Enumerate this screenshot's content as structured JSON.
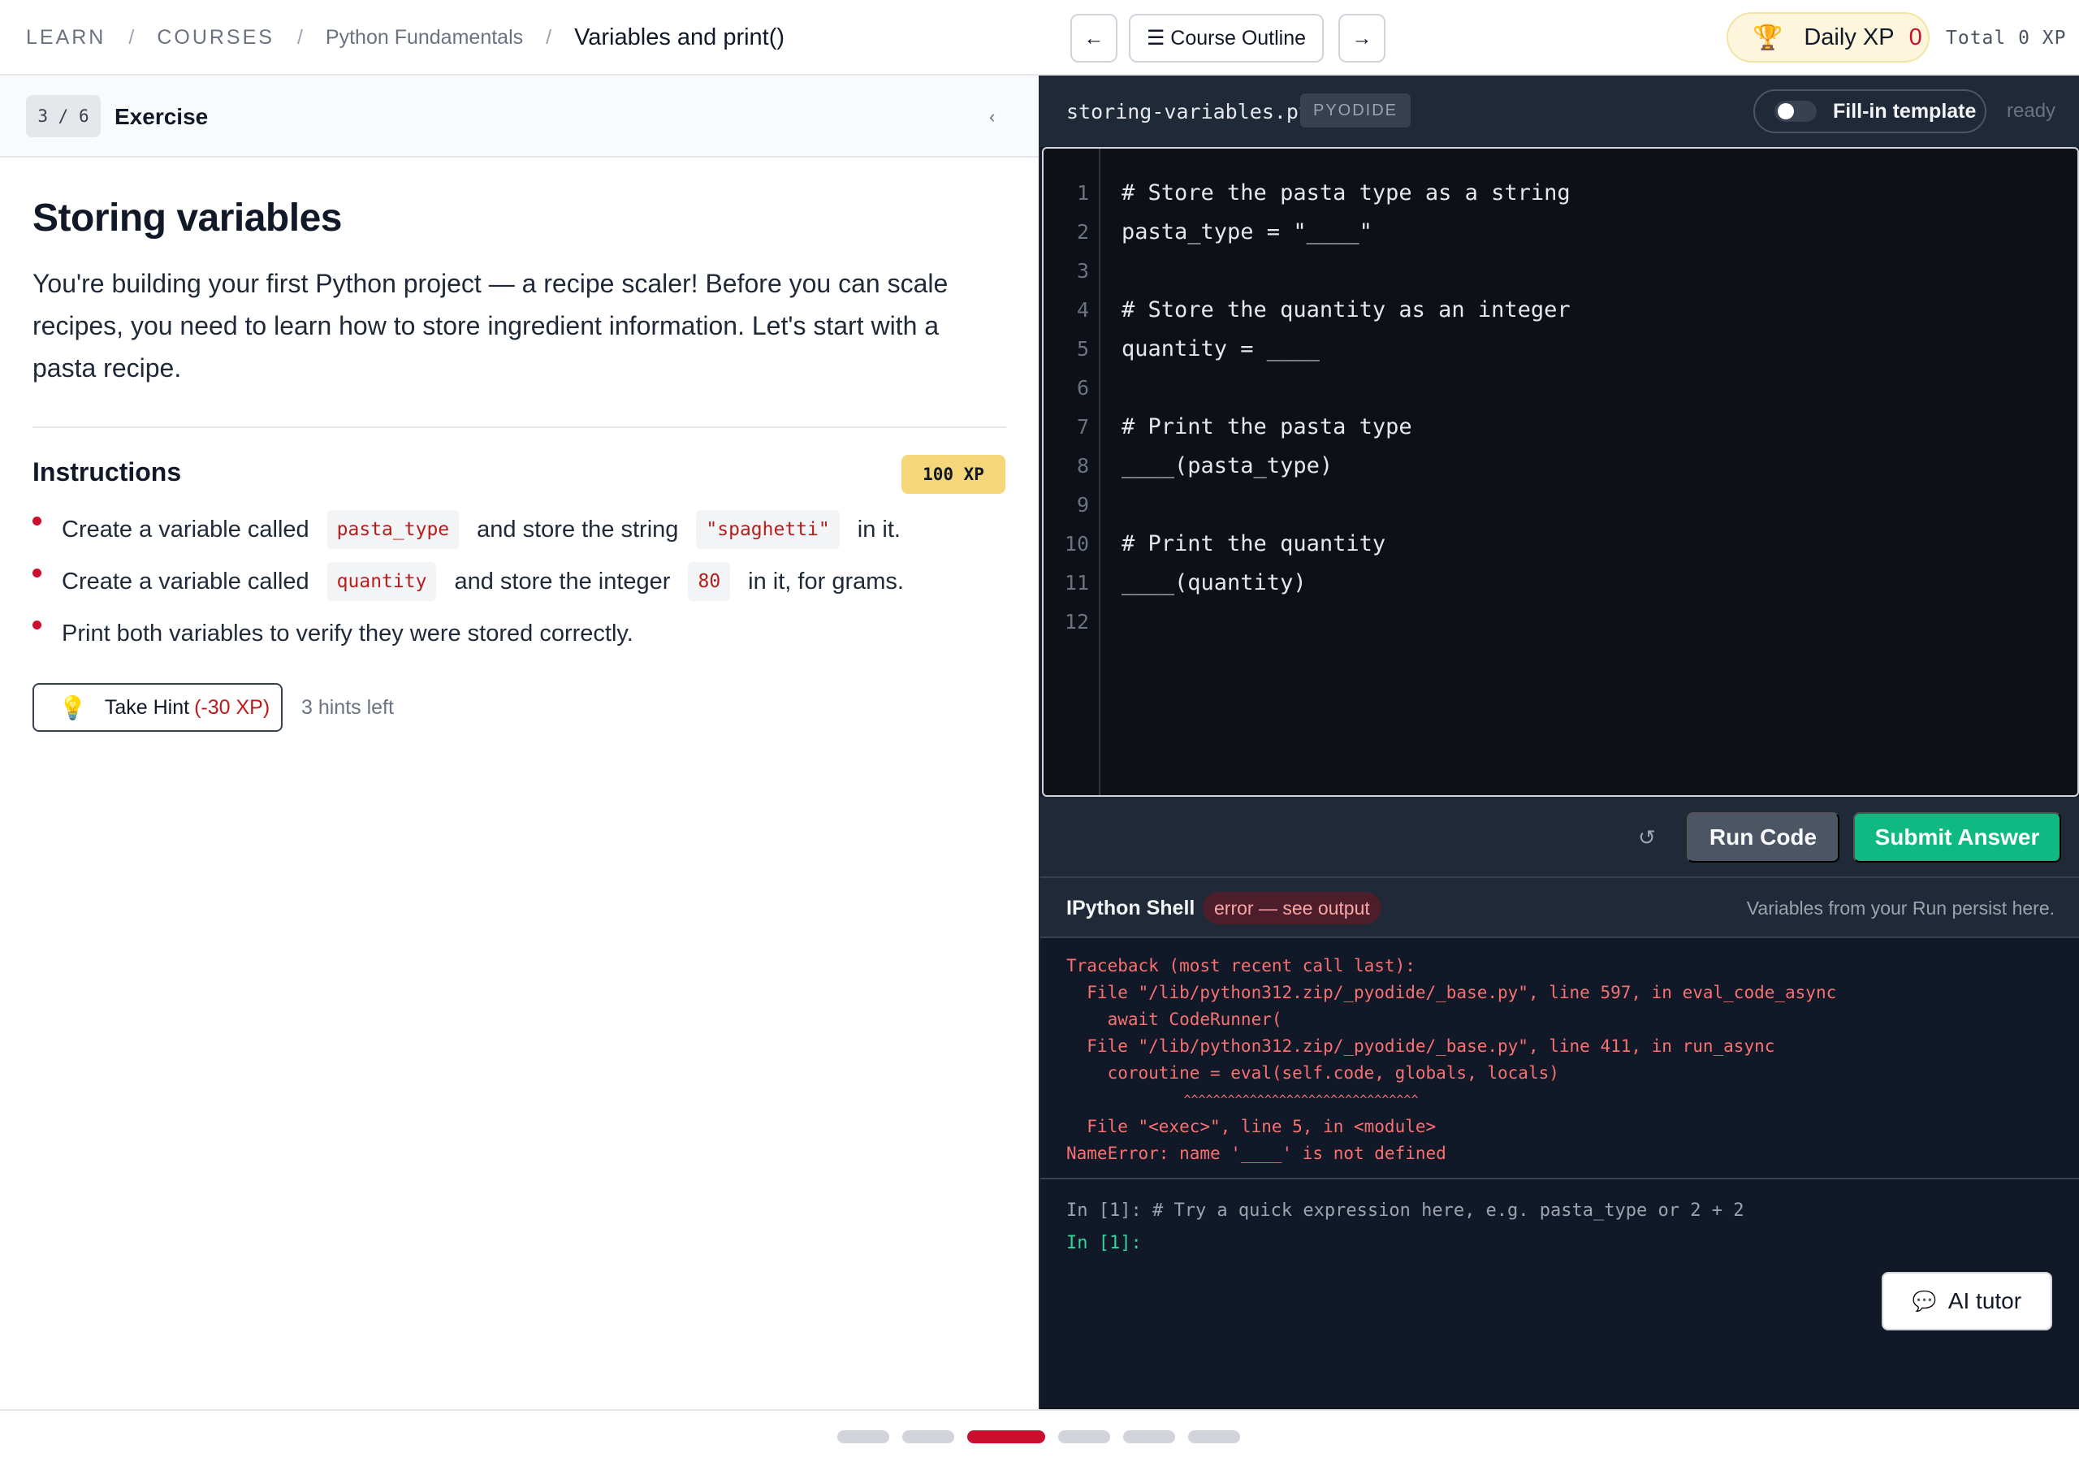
{
  "breadcrumb": {
    "items": [
      "LEARN",
      "COURSES",
      "Python Fundamentals"
    ],
    "separator": "/",
    "current": "Variables and print()"
  },
  "nav": {
    "prev_label": "←",
    "outline_label": "☰ Course Outline",
    "next_label": "→"
  },
  "xp": {
    "daily_label": "Daily XP",
    "daily_value": "0",
    "total_label": "Total 0 XP",
    "trophy_icon": "trophy-icon"
  },
  "exercise": {
    "progress": "3 / 6",
    "kind": "Exercise",
    "collapse_icon": "‹",
    "title": "Storing variables",
    "intro": "You're building your first Python project — a recipe scaler! Before you can scale recipes, you need to learn how to store ingredient information. Let's start with a pasta recipe.",
    "instructions_title": "Instructions",
    "xp_badge": "100 XP",
    "instructions": [
      {
        "a": "Create a variable called",
        "code1": "pasta_type",
        "b": "and store the string",
        "code2": "\"spaghetti\"",
        "c": "in it."
      },
      {
        "a": "Create a variable called",
        "code1": "quantity",
        "b": "and store the integer",
        "code2": "80",
        "c": "in it, for grams."
      },
      {
        "a": "Print both variables to verify they were stored correctly."
      }
    ],
    "hint_button": {
      "label": "Take Hint",
      "cost": "(-30 XP)"
    },
    "hints_left": "3 hints left"
  },
  "editor": {
    "filename": "storing-variables.py",
    "runtime": "PYODIDE",
    "template_toggle": {
      "label": "Fill-in template",
      "on": false
    },
    "status": "ready",
    "lines": [
      "# Store the pasta type as a string",
      "pasta_type = \"____\"",
      "",
      "# Store the quantity as an integer",
      "quantity = ____",
      "",
      "# Print the pasta type",
      "____(pasta_type)",
      "",
      "# Print the quantity",
      "____(quantity)",
      ""
    ],
    "line_numbers": [
      "1",
      "2",
      "3",
      "4",
      "5",
      "6",
      "7",
      "8",
      "9",
      "10",
      "11",
      "12"
    ]
  },
  "actions": {
    "reset_icon": "↺",
    "run_label": "Run Code",
    "submit_label": "Submit Answer"
  },
  "shell": {
    "title": "IPython Shell",
    "status_badge": "error — see output",
    "persist_note": "Variables from your Run persist here.",
    "traceback": [
      "Traceback (most recent call last):",
      "  File \"/lib/python312.zip/_pyodide/_base.py\", line 597, in eval_code_async",
      "    await CodeRunner(",
      "  File \"/lib/python312.zip/_pyodide/_base.py\", line 411, in run_async",
      "    coroutine = eval(self.code, globals, locals)",
      "                ^^^^^^^^^^^^^^^^^^^^^^^^^^^^^^^^",
      "  File \"<exec>\", line 5, in <module>",
      "NameError: name '____' is not defined"
    ],
    "prompt_hint": "In [1]: # Try a quick expression here, e.g. pasta_type or 2 + 2",
    "prompt_live": "In [1]:"
  },
  "ai_tutor": {
    "label": "AI tutor",
    "icon": "chat-bubble-icon"
  },
  "progress": {
    "total_steps": 6,
    "current_step": 3
  },
  "colors": {
    "accent_red": "#c8102e",
    "submit_green": "#10b981",
    "xp_gold": "#f5d77a",
    "editor_bg": "#0d1117"
  }
}
